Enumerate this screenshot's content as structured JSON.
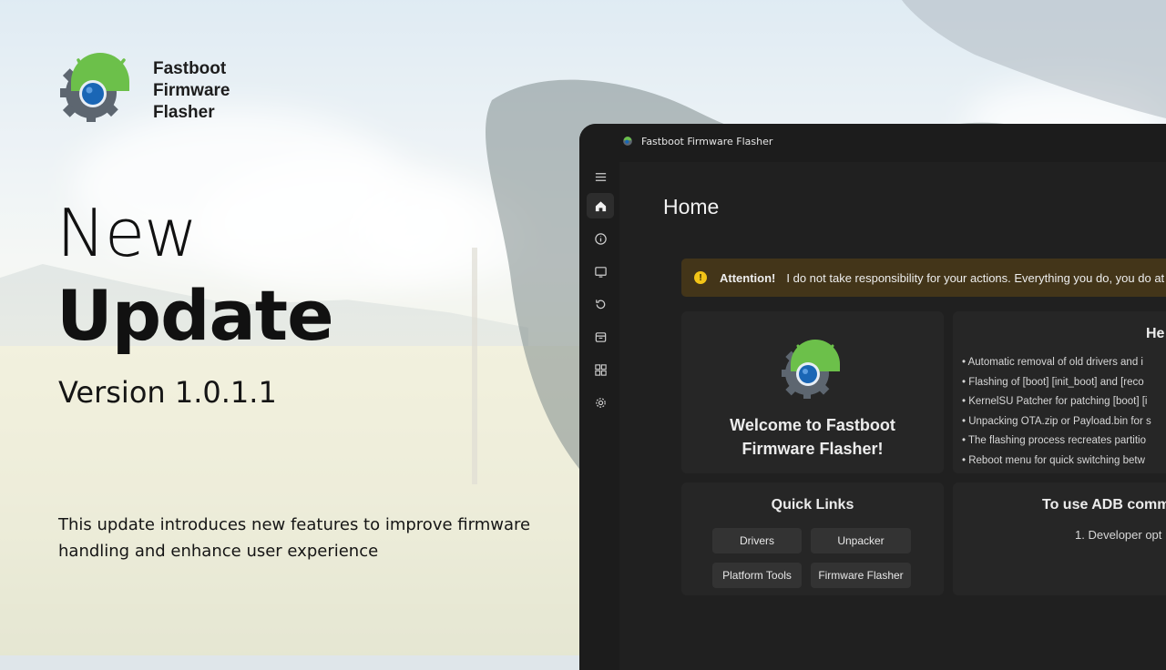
{
  "brand": {
    "name_lines": [
      "Fastboot",
      "Firmware",
      "Flasher"
    ],
    "logo_icon": "android-gear-icon"
  },
  "promo": {
    "headline_light": "New",
    "headline_bold": "Update",
    "version": "Version 1.0.1.1",
    "description": "This update introduces new features to improve firmware handling and enhance user experience"
  },
  "window": {
    "title": "Fastboot Firmware Flasher",
    "page_title": "Home",
    "sidebar": [
      {
        "icon": "menu-icon",
        "active": false
      },
      {
        "icon": "home-icon",
        "active": true
      },
      {
        "icon": "info-icon",
        "active": false
      },
      {
        "icon": "screen-icon",
        "active": false
      },
      {
        "icon": "reboot-icon",
        "active": false
      },
      {
        "icon": "package-icon",
        "active": false
      },
      {
        "icon": "grid-icon",
        "active": false
      },
      {
        "icon": "settings-icon",
        "active": false
      }
    ],
    "attention": {
      "label": "Attention!",
      "text": "I do not take responsibility for your actions. Everything you do, you do at yo"
    },
    "welcome": {
      "line1": "Welcome to Fastboot",
      "line2": "Firmware Flasher!"
    },
    "help": {
      "title": "He",
      "items": [
        "• Automatic removal of old drivers and i",
        "• Flashing of [boot] [init_boot] and [reco",
        "• KernelSU Patcher for patching [boot] [i",
        "• Unpacking OTA.zip or Payload.bin for s",
        "• The flashing process recreates partitio",
        "• Reboot menu for quick switching betw"
      ]
    },
    "quick_links": {
      "title": "Quick Links",
      "buttons": [
        "Drivers",
        "Unpacker",
        "Platform Tools",
        "Firmware Flasher"
      ]
    },
    "adb": {
      "title": "To use ADB comm",
      "step": "1. Developer opt"
    }
  },
  "colors": {
    "android_green": "#6cc04a",
    "gear_grey": "#5d6670",
    "lens_blue": "#1a66b5",
    "warning_yellow": "#f2c417"
  }
}
